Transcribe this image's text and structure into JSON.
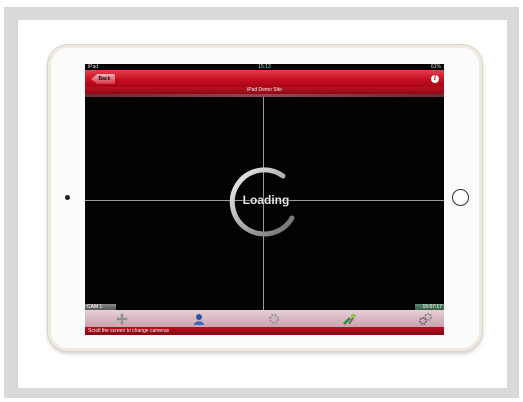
{
  "status_bar": {
    "device": "iPad",
    "time": "15:13",
    "battery": "61%"
  },
  "nav": {
    "back_label": "Back",
    "info_icon": "info-icon"
  },
  "site_name": "iPad Demo Site",
  "video": {
    "loading_text": "Loading",
    "camera_label": "CAM 1",
    "timestamp": "15:07:17"
  },
  "toolbar": [
    {
      "icon": "ptz-move-icon"
    },
    {
      "icon": "user-icon"
    },
    {
      "icon": "gear-icon"
    },
    {
      "icon": "tools-icon"
    },
    {
      "icon": "settings-gears-icon"
    }
  ],
  "footer_hint": "Scroll the screen to change cameras"
}
